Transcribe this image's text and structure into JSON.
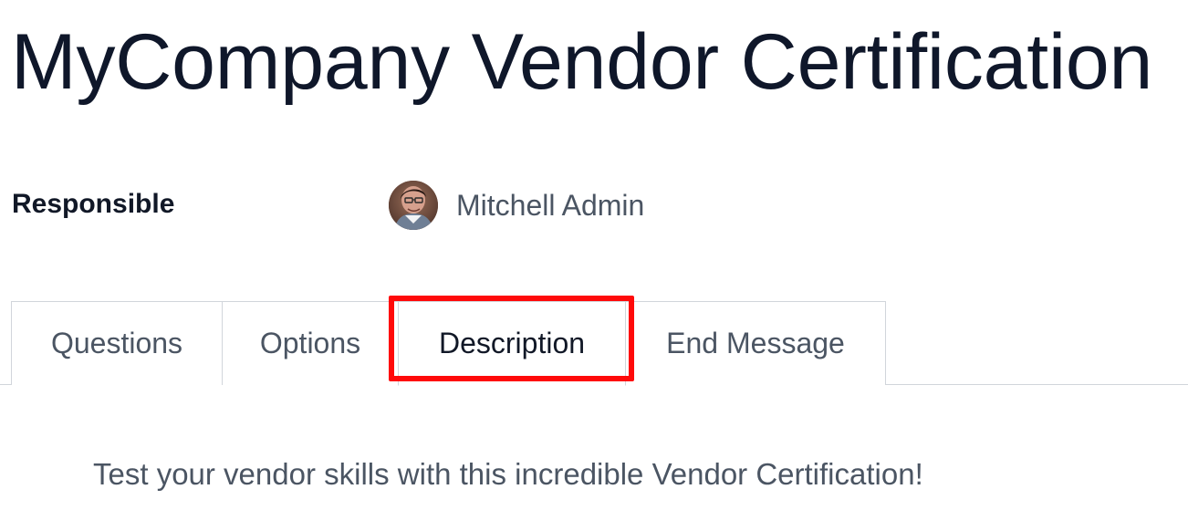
{
  "header": {
    "title": "MyCompany Vendor Certification"
  },
  "responsible": {
    "label": "Responsible",
    "user_name": "Mitchell Admin",
    "avatar_icon": "user-avatar"
  },
  "tabs": [
    {
      "label": "Questions",
      "active": false
    },
    {
      "label": "Options",
      "active": false
    },
    {
      "label": "Description",
      "active": true,
      "highlighted": true
    },
    {
      "label": "End Message",
      "active": false
    }
  ],
  "description": {
    "text": "Test your vendor skills with this incredible Vendor Certification!"
  },
  "colors": {
    "title": "#0f172a",
    "body_text": "#4b5563",
    "border": "#d1d5db",
    "highlight": "#ff0a0a",
    "background": "#ffffff"
  }
}
